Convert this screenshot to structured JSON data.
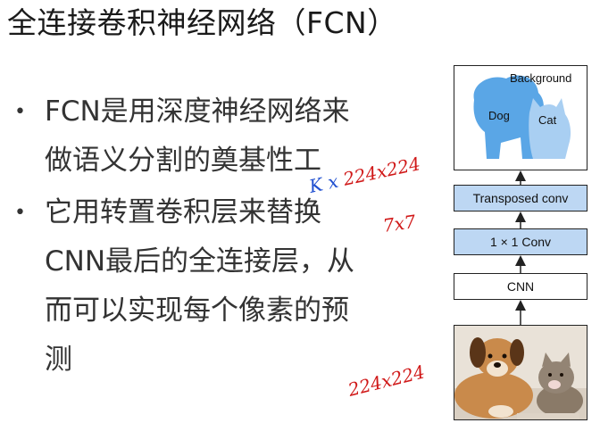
{
  "slide": {
    "title": "全连接卷积神经网络（FCN）",
    "bullets": [
      {
        "lines": [
          "FCN是用深度神经网络来",
          "做语义分割的奠基性工"
        ]
      },
      {
        "lines": [
          "它用转置卷积层来替换",
          "CNN最后的全连接层，从",
          "而可以实现每个像素的预",
          "测"
        ]
      }
    ]
  },
  "diagram": {
    "segmentation": {
      "background_label": "Background",
      "dog_label": "Dog",
      "cat_label": "Cat"
    },
    "layers": {
      "transposed": "Transposed conv",
      "conv1x1": "1 × 1 Conv",
      "cnn": "CNN"
    }
  },
  "annotations": {
    "top": "K x 224x224",
    "middle": "7x7",
    "bottom": "224x224"
  },
  "colors": {
    "layer_fill": "#bdd7f3",
    "dog_mask": "#5aa6e6",
    "cat_mask": "#a9cff2",
    "handwriting_blue": "#1f4fd0",
    "handwriting_red": "#d01818"
  }
}
